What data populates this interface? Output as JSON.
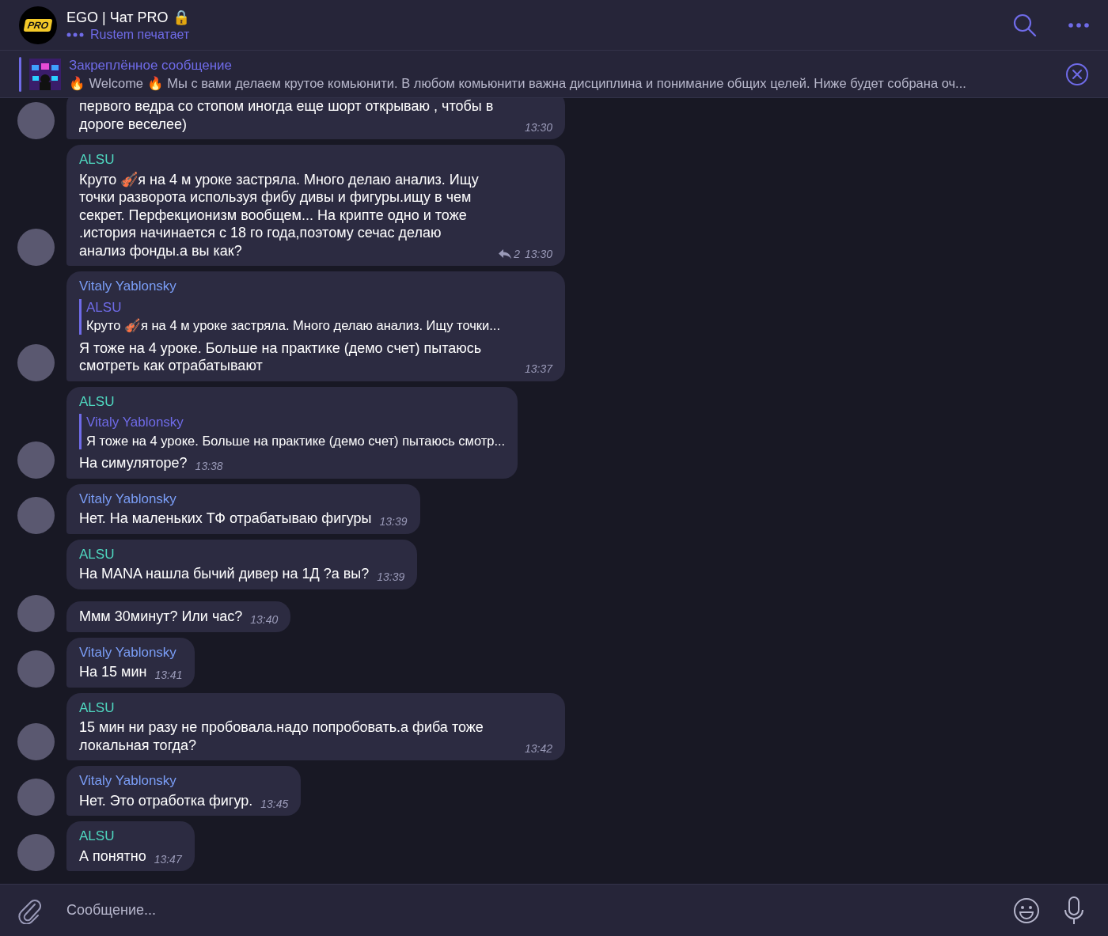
{
  "header": {
    "logo_text": "PRO",
    "title": "EGO | Чат PRO 🔒",
    "status": "Rustem печатает",
    "typing": true
  },
  "pinned": {
    "label": "Закреплённое сообщение",
    "text": "🔥 Welcome 🔥  Мы с вами делаем крутое комьюнити. В любом комьюнити важна дисциплина и понимание общих целей.  Ниже будет собрана оч..."
  },
  "messages": [
    {
      "show_avatar": true,
      "text": "первого ведра со стопом иногда еще шорт открываю , чтобы в дороге веселее)",
      "time": "13:30"
    },
    {
      "sender": "ALSU",
      "color": "#4fd8c0",
      "show_avatar": true,
      "text": "Круто 🎻я на 4 м уроке застряла. Много делаю анализ. Ищу точки разворота используя фибу дивы и фигуры.ищу в чем секрет. Перфекционизм  вообщем... На крипте одно и тоже .история начинается с 18 го года,поэтому сечас делаю анализ фонды.а вы как?",
      "replies": "2",
      "time": "13:30"
    },
    {
      "sender": "Vitaly Yablonsky",
      "color": "#7b9ef7",
      "show_avatar": true,
      "reply": {
        "sender": "ALSU",
        "text": "Круто 🎻я на 4 м уроке застряла. Много делаю анализ. Ищу точки..."
      },
      "text": "Я тоже на 4 уроке. Больше на практике (демо счет) пытаюсь смотреть как отрабатывают",
      "time": "13:37"
    },
    {
      "sender": "ALSU",
      "color": "#4fd8c0",
      "show_avatar": true,
      "reply": {
        "sender": "Vitaly Yablonsky",
        "text": "Я тоже на 4 уроке. Больше на практике (демо счет) пытаюсь смотр..."
      },
      "text": "На симуляторе?",
      "time": "13:38"
    },
    {
      "sender": "Vitaly Yablonsky",
      "color": "#7b9ef7",
      "show_avatar": true,
      "text": "Нет. На маленьких ТФ отрабатываю фигуры",
      "time": "13:39"
    },
    {
      "sender": "ALSU",
      "color": "#4fd8c0",
      "show_avatar": false,
      "text": "На MANA нашла бычий дивер на 1Д ?а вы?",
      "time": "13:39"
    },
    {
      "show_avatar": true,
      "text": "Ммм 30минут? Или час?",
      "time": "13:40"
    },
    {
      "sender": "Vitaly Yablonsky",
      "color": "#7b9ef7",
      "show_avatar": true,
      "text": "На 15 мин",
      "time": "13:41"
    },
    {
      "sender": "ALSU",
      "color": "#4fd8c0",
      "show_avatar": true,
      "text": "15 мин ни разу не пробовала.надо попробовать.а фиба тоже локальная тогда?",
      "time": "13:42"
    },
    {
      "sender": "Vitaly Yablonsky",
      "color": "#7b9ef7",
      "show_avatar": true,
      "text": "Нет. Это отработка фигур.",
      "time": "13:45"
    },
    {
      "sender": "ALSU",
      "color": "#4fd8c0",
      "show_avatar": true,
      "text": "А понятно",
      "time": "13:47"
    }
  ],
  "composer": {
    "placeholder": "Сообщение..."
  }
}
